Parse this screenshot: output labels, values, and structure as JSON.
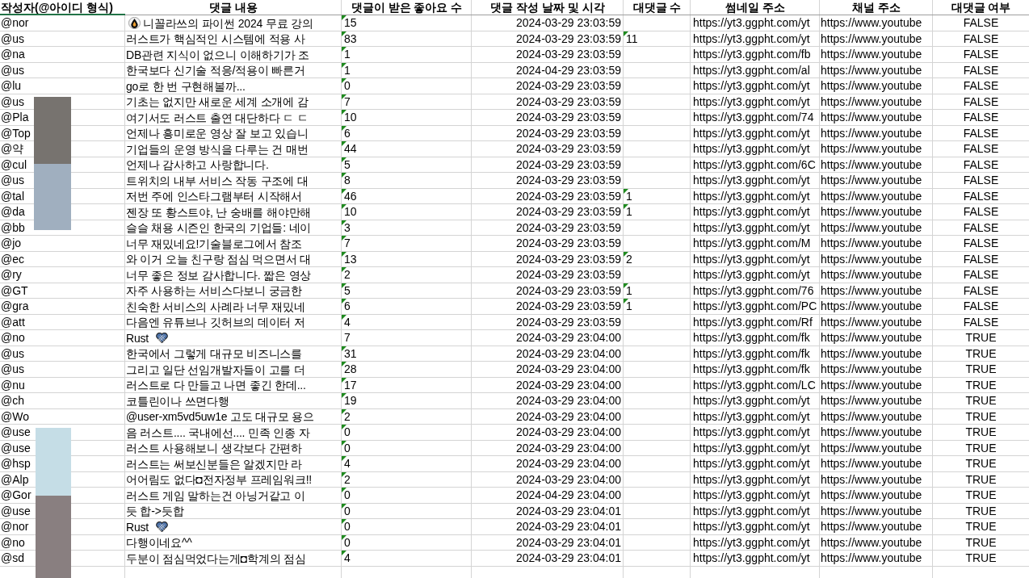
{
  "columns": [
    {
      "label": "작성자(@아이디 형식)",
      "selected": true
    },
    {
      "label": "댓글 내용",
      "selected": false
    },
    {
      "label": "댓글이 받은 좋아요 수",
      "selected": false
    },
    {
      "label": "댓글 작성 날짜 및 시각",
      "selected": false
    },
    {
      "label": "대댓글 수",
      "selected": false
    },
    {
      "label": "썸네일 주소",
      "selected": false
    },
    {
      "label": "채널 주소",
      "selected": false
    },
    {
      "label": "대댓글 여부",
      "selected": false
    }
  ],
  "rows": [
    {
      "author": "@nor",
      "kind": "leading_emoji",
      "comment": "니꼴라쓰의 파이썬 2024 무료 강의",
      "likes": {
        "value": "15",
        "flagged": true
      },
      "date": "2024-03-29 23:03:59",
      "thumbnail": "https://yt3.ggpht.com/yt",
      "channel": "https://www.youtube",
      "is_reply": "FALSE"
    },
    {
      "author": "@us",
      "kind": "plain",
      "comment": "러스트가 핵심적인 시스템에 적용 사",
      "likes": {
        "value": "83",
        "flagged": true
      },
      "date": "2024-03-29 23:03:59",
      "replies": {
        "value": "11",
        "flagged": true
      },
      "thumbnail": "https://yt3.ggpht.com/yt",
      "channel": "https://www.youtube",
      "is_reply": "FALSE"
    },
    {
      "author": "@na",
      "kind": "plain",
      "comment": "DB관련 지식이 없으니 이해하기가 조",
      "likes": {
        "value": "1",
        "flagged": true
      },
      "date": "2024-03-29 23:03:59",
      "thumbnail": "https://yt3.ggpht.com/fb",
      "channel": "https://www.youtube",
      "is_reply": "FALSE"
    },
    {
      "author": "@us",
      "kind": "plain",
      "comment": "한국보다 신기술 적응/적용이 빠른거",
      "likes": {
        "value": "1",
        "flagged": true
      },
      "date": "2024-04-29 23:03:59",
      "thumbnail": "https://yt3.ggpht.com/al",
      "channel": "https://www.youtube",
      "is_reply": "FALSE"
    },
    {
      "author": "@lu",
      "kind": "plain",
      "comment": "go로 한 번 구현해볼까...",
      "likes": {
        "value": "0",
        "flagged": true
      },
      "date": "2024-03-29 23:03:59",
      "thumbnail": "https://yt3.ggpht.com/yt",
      "channel": "https://www.youtube",
      "is_reply": "FALSE"
    },
    {
      "author": "@us",
      "kind": "plain",
      "comment": "기초는 없지만 새로운 세계 소개에 감",
      "likes": {
        "value": "7",
        "flagged": true
      },
      "date": "2024-03-29 23:03:59",
      "thumbnail": "https://yt3.ggpht.com/yt",
      "channel": "https://www.youtube",
      "is_reply": "FALSE"
    },
    {
      "author": "@Pla",
      "kind": "plain",
      "comment": "여기서도 러스트 출연 대단하다 ㄷ ㄷ",
      "likes": {
        "value": "10",
        "flagged": true
      },
      "date": "2024-03-29 23:03:59",
      "thumbnail": "https://yt3.ggpht.com/74",
      "channel": "https://www.youtube",
      "is_reply": "FALSE"
    },
    {
      "author": "@Top",
      "kind": "plain",
      "comment": "언제나 흥미로운 영상 잘 보고 있습니",
      "likes": {
        "value": "6",
        "flagged": true
      },
      "date": "2024-03-29 23:03:59",
      "thumbnail": "https://yt3.ggpht.com/yt",
      "channel": "https://www.youtube",
      "is_reply": "FALSE"
    },
    {
      "author": "@약",
      "kind": "plain",
      "comment": "기업들의 운영 방식을 다루는 건 매번",
      "likes": {
        "value": "44",
        "flagged": true
      },
      "date": "2024-03-29 23:03:59",
      "thumbnail": "https://yt3.ggpht.com/yt",
      "channel": "https://www.youtube",
      "is_reply": "FALSE"
    },
    {
      "author": "@cul",
      "kind": "plain",
      "comment": "언제나 감사하고 사랑합니다.",
      "likes": {
        "value": "5",
        "flagged": true
      },
      "date": "2024-03-29 23:03:59",
      "thumbnail": "https://yt3.ggpht.com/6C",
      "channel": "https://www.youtube",
      "is_reply": "FALSE"
    },
    {
      "author": "@us",
      "kind": "plain",
      "comment": "트위치의 내부 서비스 작동 구조에 대",
      "likes": {
        "value": "8",
        "flagged": true
      },
      "date": "2024-03-29 23:03:59",
      "thumbnail": "https://yt3.ggpht.com/yt",
      "channel": "https://www.youtube",
      "is_reply": "FALSE"
    },
    {
      "author": "@tal",
      "kind": "plain",
      "comment": "저번 주에 인스타그램부터 시작해서",
      "likes": {
        "value": "46",
        "flagged": true
      },
      "date": "2024-03-29 23:03:59",
      "replies": {
        "value": "1",
        "flagged": true
      },
      "thumbnail": "https://yt3.ggpht.com/yt",
      "channel": "https://www.youtube",
      "is_reply": "FALSE"
    },
    {
      "author": "@da",
      "kind": "plain",
      "comment": "젠장 또 황스트야, 난 숭배를 해야만해",
      "likes": {
        "value": "10",
        "flagged": true
      },
      "date": "2024-03-29 23:03:59",
      "replies": {
        "value": "1",
        "flagged": true
      },
      "thumbnail": "https://yt3.ggpht.com/yt",
      "channel": "https://www.youtube",
      "is_reply": "FALSE"
    },
    {
      "author": "@bb",
      "kind": "plain",
      "comment": "슬슬 채용 시즌인 한국의 기업들: 네이",
      "likes": {
        "value": "3",
        "flagged": true
      },
      "date": "2024-03-29 23:03:59",
      "thumbnail": "https://yt3.ggpht.com/yt",
      "channel": "https://www.youtube",
      "is_reply": "FALSE"
    },
    {
      "author": "@jo",
      "kind": "plain",
      "comment": "너무 재밌네요!기술블로그에서 참조",
      "likes": {
        "value": "7",
        "flagged": true
      },
      "date": "2024-03-29 23:03:59",
      "thumbnail": "https://yt3.ggpht.com/M",
      "channel": "https://www.youtube",
      "is_reply": "FALSE"
    },
    {
      "author": "@ec",
      "kind": "plain",
      "comment": "와 이거 오늘 친구랑 점심 먹으면서 대",
      "likes": {
        "value": "13",
        "flagged": true
      },
      "date": "2024-03-29 23:03:59",
      "replies": {
        "value": "2",
        "flagged": true
      },
      "thumbnail": "https://yt3.ggpht.com/yt",
      "channel": "https://www.youtube",
      "is_reply": "FALSE"
    },
    {
      "author": "@ry",
      "kind": "plain",
      "comment": "너무 좋은 정보 감사합니다. 짧은 영상",
      "likes": {
        "value": "2",
        "flagged": true
      },
      "date": "2024-03-29 23:03:59",
      "thumbnail": "https://yt3.ggpht.com/yt",
      "channel": "https://www.youtube",
      "is_reply": "FALSE"
    },
    {
      "author": "@GT",
      "kind": "plain",
      "comment": "자주 사용하는 서비스다보니 궁금한",
      "likes": {
        "value": "5",
        "flagged": true
      },
      "date": "2024-03-29 23:03:59",
      "replies": {
        "value": "1",
        "flagged": true
      },
      "thumbnail": "https://yt3.ggpht.com/76",
      "channel": "https://www.youtube",
      "is_reply": "FALSE"
    },
    {
      "author": "@gra",
      "kind": "plain",
      "comment": "친숙한 서비스의 사례라 너무 재밌네",
      "likes": {
        "value": "6",
        "flagged": true
      },
      "date": "2024-03-29 23:03:59",
      "replies": {
        "value": "1",
        "flagged": true
      },
      "thumbnail": "https://yt3.ggpht.com/PC",
      "channel": "https://www.youtube",
      "is_reply": "FALSE"
    },
    {
      "author": "@att",
      "kind": "plain",
      "comment": "다음엔 유튜브나 깃허브의 데이터 저",
      "likes": {
        "value": "4",
        "flagged": true
      },
      "date": "2024-03-29 23:03:59",
      "thumbnail": "https://yt3.ggpht.com/Rf",
      "channel": "https://www.youtube",
      "is_reply": "FALSE"
    },
    {
      "author": "@no",
      "kind": "trailing_emoji",
      "comment": "Rust",
      "likes": {
        "value": "7",
        "flagged": false
      },
      "date": "2024-03-29 23:04:00",
      "thumbnail": "https://yt3.ggpht.com/fk",
      "channel": "https://www.youtube",
      "is_reply": "TRUE"
    },
    {
      "author": "@us",
      "kind": "plain",
      "comment": "한국에서 그렇게 대규모 비즈니스를",
      "likes": {
        "value": "31",
        "flagged": true
      },
      "date": "2024-03-29 23:04:00",
      "thumbnail": "https://yt3.ggpht.com/fk",
      "channel": "https://www.youtube",
      "is_reply": "TRUE"
    },
    {
      "author": "@us",
      "kind": "plain",
      "comment": "그리고 일단 선임개발자들이 고를 더",
      "likes": {
        "value": "28",
        "flagged": true
      },
      "date": "2024-03-29 23:04:00",
      "thumbnail": "https://yt3.ggpht.com/fk",
      "channel": "https://www.youtube",
      "is_reply": "TRUE"
    },
    {
      "author": "@nu",
      "kind": "plain",
      "comment": "러스트로 다 만들고 나면 좋긴 한데...",
      "likes": {
        "value": "17",
        "flagged": true
      },
      "date": "2024-03-29 23:04:00",
      "thumbnail": "https://yt3.ggpht.com/LC",
      "channel": "https://www.youtube",
      "is_reply": "TRUE"
    },
    {
      "author": "@ch",
      "kind": "plain",
      "comment": "코틀린이나 쓰면다행",
      "likes": {
        "value": "19",
        "flagged": true
      },
      "date": "2024-03-29 23:04:00",
      "thumbnail": "https://yt3.ggpht.com/yt",
      "channel": "https://www.youtube",
      "is_reply": "TRUE"
    },
    {
      "author": "@Wo",
      "kind": "plain",
      "comment": "@user-xm5vd5uw1e  고도 대규모 용으",
      "likes": {
        "value": "2",
        "flagged": true
      },
      "date": "2024-03-29 23:04:00",
      "thumbnail": "https://yt3.ggpht.com/yt",
      "channel": "https://www.youtube",
      "is_reply": "TRUE"
    },
    {
      "author": "@use",
      "kind": "plain",
      "comment": "음 러스트.... 국내에선.... 민족 인종 자",
      "likes": {
        "value": "0",
        "flagged": true
      },
      "date": "2024-03-29 23:04:00",
      "thumbnail": "https://yt3.ggpht.com/yt",
      "channel": "https://www.youtube",
      "is_reply": "TRUE"
    },
    {
      "author": "@use",
      "kind": "plain",
      "comment": "러스트 사용해보니 생각보다 간편하",
      "likes": {
        "value": "0",
        "flagged": true
      },
      "date": "2024-03-29 23:04:00",
      "thumbnail": "https://yt3.ggpht.com/yt",
      "channel": "https://www.youtube",
      "is_reply": "TRUE"
    },
    {
      "author": "@hsp",
      "kind": "plain",
      "comment": "러스트는 써보신분들은 알겠지만 라",
      "likes": {
        "value": "4",
        "flagged": true
      },
      "date": "2024-03-29 23:04:00",
      "thumbnail": "https://yt3.ggpht.com/yt",
      "channel": "https://www.youtube",
      "is_reply": "TRUE"
    },
    {
      "author": "@Alp",
      "kind": "plain",
      "comment": "어어림도 없다◘전자정부 프레임워크!!",
      "likes": {
        "value": "2",
        "flagged": true
      },
      "date": "2024-03-29 23:04:00",
      "thumbnail": "https://yt3.ggpht.com/yt",
      "channel": "https://www.youtube",
      "is_reply": "TRUE"
    },
    {
      "author": "@Gor",
      "kind": "plain",
      "comment": "러스트 게임 말하는건 아닝거같고 이",
      "likes": {
        "value": "0",
        "flagged": true
      },
      "date": "2024-04-29 23:04:00",
      "thumbnail": "https://yt3.ggpht.com/yt",
      "channel": "https://www.youtube",
      "is_reply": "TRUE"
    },
    {
      "author": "@use",
      "kind": "plain",
      "comment": "듯 합->듯합",
      "likes": {
        "value": "0",
        "flagged": true
      },
      "date": "2024-03-29 23:04:01",
      "thumbnail": "https://yt3.ggpht.com/yt",
      "channel": "https://www.youtube",
      "is_reply": "TRUE"
    },
    {
      "author": "@nor",
      "kind": "trailing_emoji",
      "comment": "Rust",
      "likes": {
        "value": "0",
        "flagged": true
      },
      "date": "2024-03-29 23:04:01",
      "thumbnail": "https://yt3.ggpht.com/yt",
      "channel": "https://www.youtube",
      "is_reply": "TRUE"
    },
    {
      "author": "@no",
      "kind": "plain",
      "comment": "다행이네요^^",
      "likes": {
        "value": "0",
        "flagged": true
      },
      "date": "2024-03-29 23:04:01",
      "thumbnail": "https://yt3.ggpht.com/yt",
      "channel": "https://www.youtube",
      "is_reply": "TRUE"
    },
    {
      "author": "@sd",
      "kind": "plain",
      "comment": "두분이 점심먹었다는게◘학계의 점심",
      "likes": {
        "value": "4",
        "flagged": true
      },
      "date": "2024-03-29 23:04:01",
      "thumbnail": "https://yt3.ggpht.com/yt",
      "channel": "https://www.youtube",
      "is_reply": "TRUE"
    }
  ]
}
